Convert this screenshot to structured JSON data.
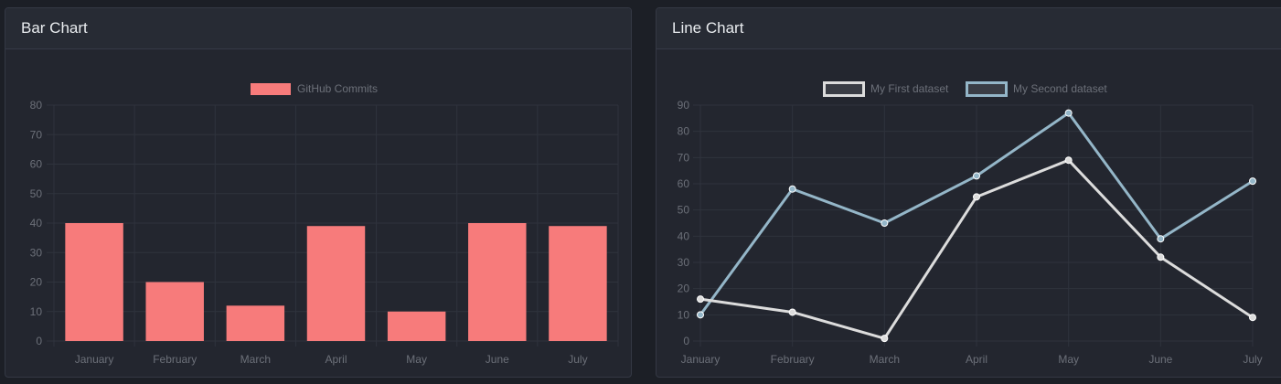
{
  "cards": {
    "bar": {
      "title": "Bar Chart"
    },
    "line": {
      "title": "Line Chart"
    }
  },
  "colors": {
    "bar_fill": "#f77b7b",
    "line1": "#dcdcdc",
    "line2": "#94b6c8",
    "grid": "#2f333d",
    "tick_text": "#6c7079"
  },
  "chart_data": [
    {
      "type": "bar",
      "title": "",
      "categories": [
        "January",
        "February",
        "March",
        "April",
        "May",
        "June",
        "July"
      ],
      "series": [
        {
          "name": "GitHub Commits",
          "values": [
            40,
            20,
            12,
            39,
            10,
            40,
            39
          ]
        }
      ],
      "ylim": [
        0,
        80
      ],
      "yticks": [
        0,
        10,
        20,
        30,
        40,
        50,
        60,
        70,
        80
      ],
      "grid": true,
      "legend": "top"
    },
    {
      "type": "line",
      "title": "",
      "categories": [
        "January",
        "February",
        "March",
        "April",
        "May",
        "June",
        "July"
      ],
      "series": [
        {
          "name": "My First dataset",
          "values": [
            16,
            11,
            1,
            55,
            69,
            32,
            9
          ]
        },
        {
          "name": "My Second dataset",
          "values": [
            10,
            58,
            45,
            63,
            87,
            39,
            61
          ]
        }
      ],
      "ylim": [
        0,
        90
      ],
      "yticks": [
        0,
        10,
        20,
        30,
        40,
        50,
        60,
        70,
        80,
        90
      ],
      "grid": true,
      "legend": "top"
    }
  ]
}
